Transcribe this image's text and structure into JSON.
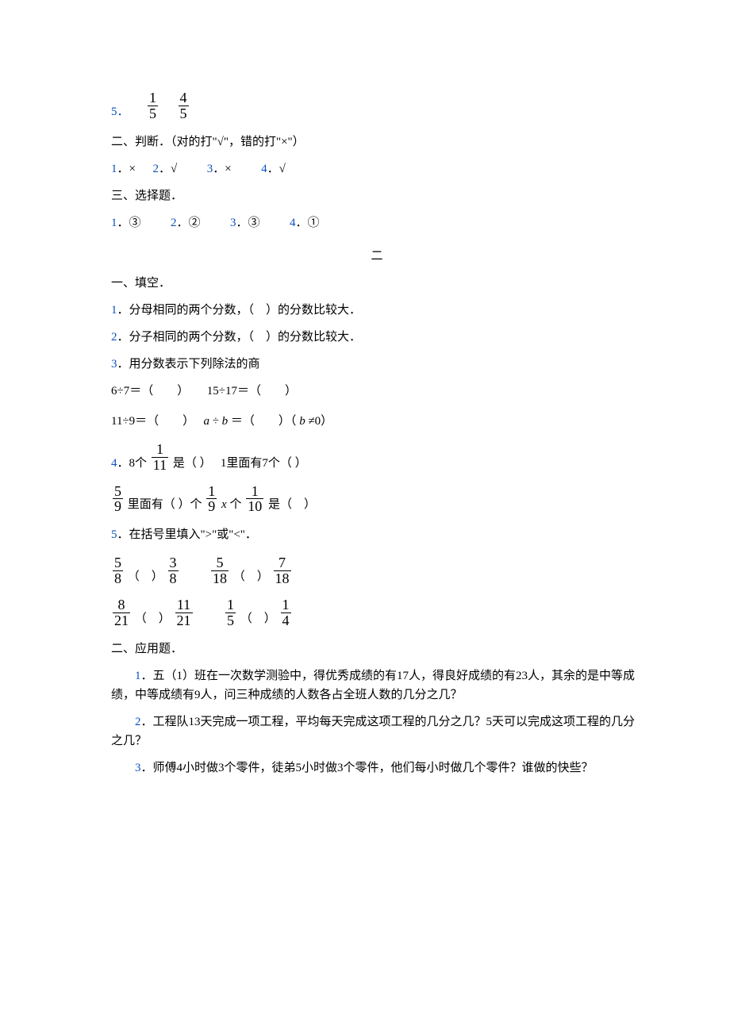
{
  "answers": {
    "q5": {
      "num_label": "5",
      "dot": "．",
      "frac1_num": "1",
      "frac1_den": "5",
      "frac2_num": "4",
      "frac2_den": "5"
    },
    "judge": {
      "heading": "二、判断．（对的打\"√\"，错的打\"×\"）",
      "a1n": "1",
      "a1": "．×",
      "a2n": "2",
      "a2": "．√",
      "a3n": "3",
      "a3": "．×",
      "a4n": "4",
      "a4": "．√"
    },
    "choice": {
      "heading": "三、选择题．",
      "a1n": "1",
      "a1": "．③",
      "a2n": "2",
      "a2": "．②",
      "a3n": "3",
      "a3": "．③",
      "a4n": "4",
      "a4": "．①"
    }
  },
  "part2": {
    "title": "二",
    "fill": {
      "heading": "一、填空．",
      "q1n": "1",
      "q1": "．分母相同的两个分数，（　）的分数比较大．",
      "q2n": "2",
      "q2": "．分子相同的两个分数，（　）的分数比较大．",
      "q3n": "3",
      "q3": "．用分数表示下列除法的商",
      "q3l1": "6÷7＝（　　）　　15÷17＝（　　）",
      "q3l2a": "11÷9＝（　　）　",
      "q3l2b": "＝（　　）（",
      "q3l2c": "≠0）",
      "q4n": "4",
      "q4a": "．8个",
      "q4_frac_num": "1",
      "q4_frac_den": "11",
      "q4b": "是（ ）　  1里面有7个（ ）",
      "q4c_frac1_num": "5",
      "q4c_frac1_den": "9",
      "q4c_mid1": "里面有（ ）个",
      "q4c_frac2_num": "1",
      "q4c_frac2_den": "9",
      "q4c_x": "x",
      "q4c_mid2": "个",
      "q4c_frac3_num": "1",
      "q4c_frac3_den": "10",
      "q4c_end": "是（　）",
      "q5n": "5",
      "q5": "．在括号里填入\">\"或\"<\"．",
      "q5r1_f1n": "5",
      "q5r1_f1d": "8",
      "q5r1_f2n": "3",
      "q5r1_f2d": "8",
      "q5r1_f3n": "5",
      "q5r1_f3d": "18",
      "q5r1_f4n": "7",
      "q5r1_f4d": "18",
      "q5r2_f1n": "8",
      "q5r2_f1d": "21",
      "q5r2_f2n": "11",
      "q5r2_f2d": "21",
      "q5r2_f3n": "1",
      "q5r2_f3d": "5",
      "q5r2_f4n": "1",
      "q5r2_f4d": "4",
      "paren": "（　）"
    },
    "app": {
      "heading": "二、应用题．",
      "q1n": "1",
      "q1": "．五（1）班在一次数学测验中，得优秀成绩的有17人，得良好成绩的有23人，其余的是中等成绩，中等成绩有9人，问三种成绩的人数各占全班人数的几分之几？",
      "q2n": "2",
      "q2": "．工程队13天完成一项工程，平均每天完成这项工程的几分之几？5天可以完成这项工程的几分之几？",
      "q3n": "3",
      "q3": "．师傅4小时做3个零件，徒弟5小时做3个零件，他们每小时做几个零件？谁做的快些？"
    }
  },
  "math": {
    "a": "a",
    "b": "b",
    "div": "÷"
  }
}
